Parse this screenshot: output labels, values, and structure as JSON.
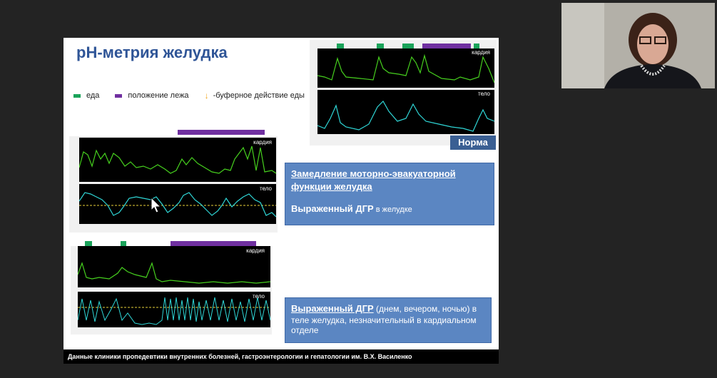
{
  "slide": {
    "title": "pH-метрия желудка",
    "legend": {
      "food": "еда",
      "lying": "положение лежа",
      "buffer": "-буферное действие еды"
    },
    "norm_label": "Норма",
    "labels": {
      "kardia": "кардия",
      "telo": "тело"
    },
    "box1": {
      "heading": "Замедление моторно-эвакуаторной функции желудка",
      "line2_bold": "Выраженный ДГР",
      "line2_rest": " в желудке"
    },
    "box2": {
      "heading": "Выраженный ДГР",
      "rest": " (днем, вечером, ночью) в теле желудка, незначительный в кардиальном отделе"
    },
    "footer": "Данные клиники пропедевтики внутренних болезней, гастроэнтерологии и гепатологии им. В.Х. Василенко"
  },
  "colors": {
    "food": "#1aa35a",
    "lying": "#7030a0",
    "buffer": "#f2a61e",
    "kardia_trace": "#46d01e",
    "telo_trace": "#2fd6d6",
    "box": "#5b86c2",
    "title": "#2f5597"
  },
  "icons": [
    "pointer-cursor-icon",
    "buffer-arrow-icon"
  ]
}
